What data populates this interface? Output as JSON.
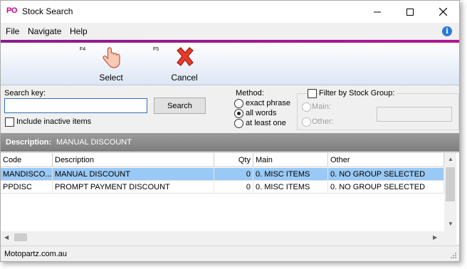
{
  "window": {
    "app_icon": "PO",
    "title": "Stock Search"
  },
  "menu": {
    "items": [
      "File",
      "Navigate",
      "Help"
    ],
    "underlines": [
      "F",
      "",
      "H"
    ]
  },
  "toolbar": {
    "select": {
      "fkey": "F4",
      "label": "Select",
      "icon": "hand-pointer-icon"
    },
    "cancel": {
      "fkey": "F5",
      "label": "Cancel",
      "icon": "red-x-icon"
    }
  },
  "search": {
    "label": "Search key:",
    "value": "",
    "placeholder": "",
    "button_label": "Search",
    "include_inactive_label": "Include inactive items",
    "include_inactive_checked": false
  },
  "method": {
    "label": "Method:",
    "options": [
      "exact phrase",
      "all words",
      "at least one"
    ],
    "selected": "all words"
  },
  "stock_group": {
    "filter_label": "Filter by Stock Group:",
    "filter_checked": false,
    "main_label": "Main:",
    "other_label": "Other:",
    "other_value": ""
  },
  "description": {
    "label": "Description:",
    "value": "MANUAL DISCOUNT"
  },
  "grid": {
    "columns": [
      "Code",
      "Description",
      "Qty",
      "Main",
      "Other"
    ],
    "rows": [
      {
        "code": "MANDISCO...",
        "description": "MANUAL DISCOUNT",
        "qty": "0",
        "main": "0. MISC ITEMS",
        "other": "0. NO GROUP SELECTED",
        "selected": true
      },
      {
        "code": "PPDISC",
        "description": "PROMPT PAYMENT DISCOUNT",
        "qty": "0",
        "main": "0. MISC ITEMS",
        "other": "0. NO GROUP SELECTED",
        "selected": false
      }
    ]
  },
  "status": {
    "text": "Motopartz.com.au"
  },
  "colors": {
    "accent": "#a0198f",
    "selection": "#99c9f5",
    "toolbar_gradient_end": "#dde6f4"
  }
}
